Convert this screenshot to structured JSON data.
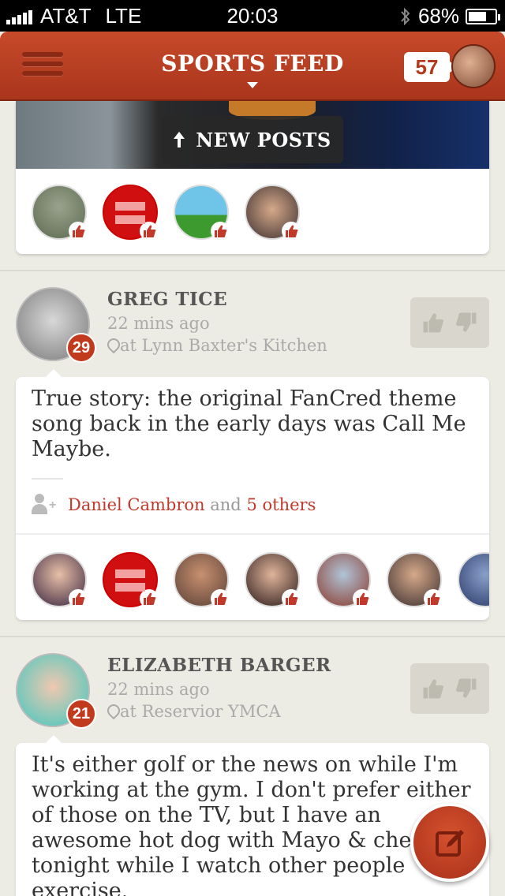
{
  "status_bar": {
    "carrier": "AT&T",
    "network": "LTE",
    "time": "20:03",
    "battery_percent": "68%",
    "battery_level": 0.68
  },
  "header": {
    "title": "SPORTS FEED",
    "notification_count": "57"
  },
  "new_posts": {
    "label": "NEW POSTS"
  },
  "posts": [
    {
      "author": "GREG TICE",
      "rank": "29",
      "time_ago": "22 mins ago",
      "location": "at Lynn Baxter's Kitchen",
      "text": "True story: the original FanCred theme song back in the early days was Call Me Maybe.",
      "likes": {
        "first_name": "Daniel Cambron",
        "joiner": "and",
        "others": "5 others"
      }
    },
    {
      "author": "ELIZABETH BARGER",
      "rank": "21",
      "time_ago": "22 mins ago",
      "location": "at Reservior YMCA",
      "text": "It's either golf or the news on while I'm working at the gym. I don't prefer either of those on the TV, but I have an awesome hot dog with Mayo & cheese tonight while I watch other people exercise."
    }
  ],
  "colors": {
    "brand_red": "#b23a1e",
    "background": "#ecebe4",
    "link_red": "#c0392b"
  }
}
